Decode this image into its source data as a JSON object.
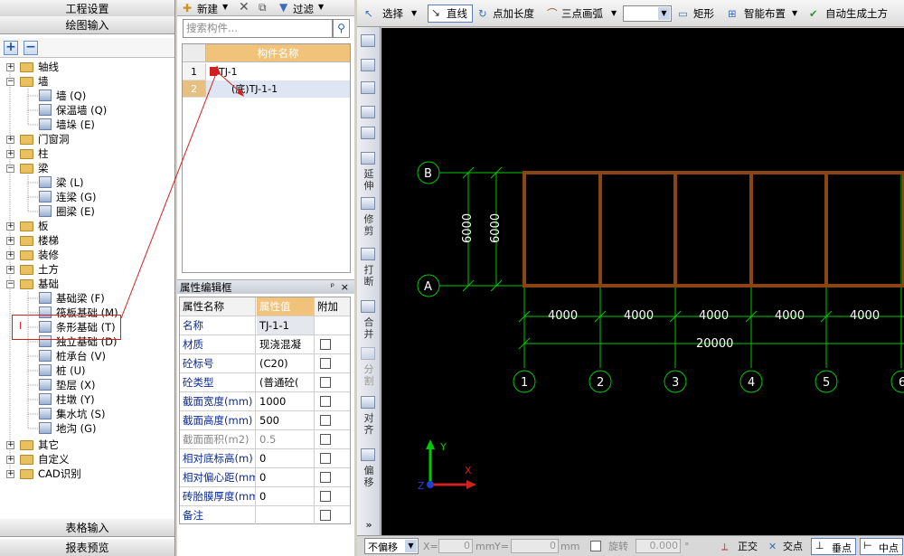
{
  "left_panel": {
    "band_top": "工程设置",
    "band_draw": "绘图输入",
    "band_table": "表格输入",
    "band_report": "报表预览",
    "tree": [
      {
        "label": "轴线"
      },
      {
        "label": "墙"
      },
      {
        "label": "墙 (Q)"
      },
      {
        "label": "保温墙 (Q)"
      },
      {
        "label": "墙垛 (E)"
      },
      {
        "label": "门窗洞"
      },
      {
        "label": "柱"
      },
      {
        "label": "梁"
      },
      {
        "label": "梁 (L)"
      },
      {
        "label": "连梁 (G)"
      },
      {
        "label": "圈梁 (E)"
      },
      {
        "label": "板"
      },
      {
        "label": "楼梯"
      },
      {
        "label": "装修"
      },
      {
        "label": "土方"
      },
      {
        "label": "基础"
      },
      {
        "label": "基础梁 (F)"
      },
      {
        "label": "筏板基础 (M)"
      },
      {
        "label": "条形基础 (T)"
      },
      {
        "label": "独立基础 (D)"
      },
      {
        "label": "桩承台 (V)"
      },
      {
        "label": "桩 (U)"
      },
      {
        "label": "垫层 (X)"
      },
      {
        "label": "柱墩 (Y)"
      },
      {
        "label": "集水坑 (S)"
      },
      {
        "label": "地沟 (G)"
      },
      {
        "label": "其它"
      },
      {
        "label": "自定义"
      },
      {
        "label": "CAD识别"
      }
    ],
    "marker": "I"
  },
  "mid_panel": {
    "toolbar": {
      "new_label": "新建",
      "filter_label": "过滤"
    },
    "search_placeholder": "搜索构件...",
    "grid_header": "构件名称",
    "rows": [
      {
        "num": "1",
        "value": "TJ-1"
      },
      {
        "num": "2",
        "value": "(底)TJ-1-1"
      }
    ],
    "prop_title": "属性编辑框",
    "prop_pin": "ᵖ",
    "prop_close": "×",
    "prop_headers": {
      "k": "属性名称",
      "v": "属性值",
      "a": "附加"
    },
    "props": [
      {
        "k": "名称",
        "v": "TJ-1-1"
      },
      {
        "k": "材质",
        "v": "现浇混凝"
      },
      {
        "k": "砼标号",
        "v": "(C20)"
      },
      {
        "k": "砼类型",
        "v": "(普通砼("
      },
      {
        "k": "截面宽度(mm)",
        "v": "1000"
      },
      {
        "k": "截面高度(mm)",
        "v": "500"
      },
      {
        "k": "截面面积(m2)",
        "v": "0.5"
      },
      {
        "k": "相对底标高(m)",
        "v": "0"
      },
      {
        "k": "相对偏心距(mm)",
        "v": "0"
      },
      {
        "k": "砖胎膜厚度(mm)",
        "v": "0"
      },
      {
        "k": "备注",
        "v": ""
      }
    ]
  },
  "top_toolbar": {
    "select": "选择",
    "line": "直线",
    "point_length": "点加长度",
    "three_point_arc": "三点画弧",
    "rect": "矩形",
    "smart_layout": "智能布置",
    "auto_earth": "自动生成土方"
  },
  "vertical_toolbar": {
    "extend": "延伸",
    "trim": "修剪",
    "break": "打断",
    "merge": "合并",
    "split": "分割",
    "align": "对齐",
    "offset": "偏移",
    "more": "»"
  },
  "drawing": {
    "axis_labels_y": [
      "B",
      "A"
    ],
    "axis_labels_x": [
      "1",
      "2",
      "3",
      "4",
      "5",
      "6"
    ],
    "dim_vertical": [
      "6000",
      "6000"
    ],
    "dim_spans": [
      "4000",
      "4000",
      "4000",
      "4000",
      "4000"
    ],
    "dim_total": "20000",
    "axis_x": "X",
    "axis_y": "Y",
    "axis_z": "Z",
    "colors": {
      "grid": "#00c800",
      "beam": "#8b4513",
      "bg": "#000000"
    }
  },
  "status_bar": {
    "offset_mode": "不偏移",
    "x_label": "X=",
    "x_value": "0",
    "y_label": "Y=",
    "y_value": "0",
    "unit": "mm",
    "rotate_label": "旋转",
    "rotate_value": "0.000",
    "deg": "°",
    "ortho": "正交",
    "intersect": "交点",
    "perp": "垂点",
    "mid": "中点"
  }
}
